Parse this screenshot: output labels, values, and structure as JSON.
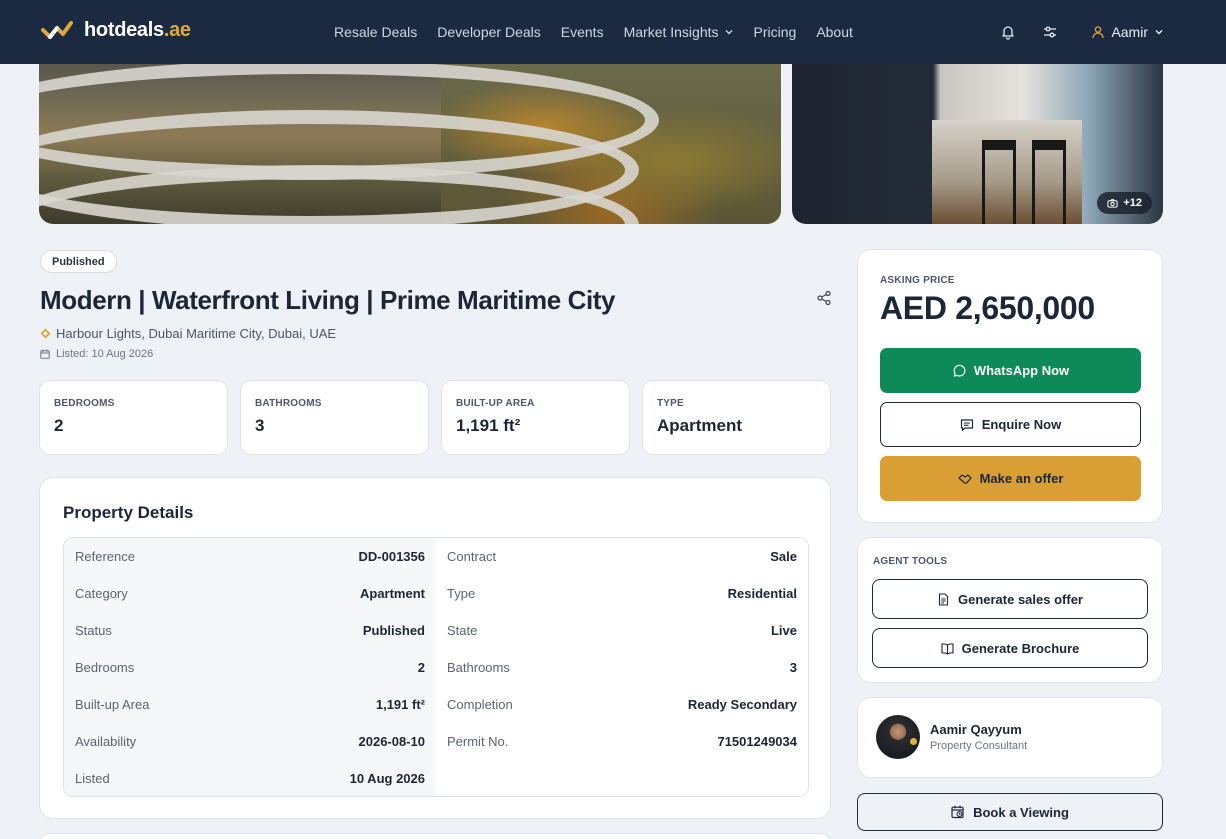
{
  "brand": {
    "name": "hotdeals",
    "tld": ".ae",
    "accent": "#e0a83a",
    "nav_bg": "#1b2a40"
  },
  "nav": {
    "items": [
      {
        "label": "Resale Deals"
      },
      {
        "label": "Developer Deals"
      },
      {
        "label": "Events"
      },
      {
        "label": "Market Insights",
        "dropdown": true
      },
      {
        "label": "Pricing"
      },
      {
        "label": "About"
      }
    ],
    "user": "Aamir",
    "icons": [
      "bell-icon",
      "sliders-icon",
      "user-icon",
      "chevron-down-icon"
    ]
  },
  "gallery": {
    "photo_count": "+12"
  },
  "listing": {
    "status": "Published",
    "title": "Modern | Waterfront Living | Prime Maritime City",
    "location": "Harbour Lights, Dubai Maritime City, Dubai, UAE",
    "listed": "Listed: 10 Aug 2026"
  },
  "stats": [
    {
      "label": "BEDROOMS",
      "value": "2"
    },
    {
      "label": "BATHROOMS",
      "value": "3"
    },
    {
      "label": "BUILT-UP AREA",
      "value": "1,191 ft²"
    },
    {
      "label": "TYPE",
      "value": "Apartment"
    }
  ],
  "details": {
    "heading": "Property Details",
    "rows": [
      {
        "lk": "Reference",
        "lv": "DD-001356",
        "rk": "Contract",
        "rv": "Sale"
      },
      {
        "lk": "Category",
        "lv": "Apartment",
        "rk": "Type",
        "rv": "Residential"
      },
      {
        "lk": "Status",
        "lv": "Published",
        "rk": "State",
        "rv": "Live"
      },
      {
        "lk": "Bedrooms",
        "lv": "2",
        "rk": "Bathrooms",
        "rv": "3"
      },
      {
        "lk": "Built-up Area",
        "lv": "1,191 ft²",
        "rk": "Completion",
        "rv": "Ready Secondary"
      },
      {
        "lk": "Availability",
        "lv": "2026-08-10",
        "rk": "Permit No.",
        "rv": "71501249034"
      },
      {
        "lk": "Listed",
        "lv": "10 Aug 2026",
        "rk": "",
        "rv": ""
      }
    ]
  },
  "pricing": {
    "label": "ASKING PRICE",
    "price": "AED 2,650,000",
    "whatsapp": "WhatsApp Now",
    "enquire": "Enquire Now",
    "offer": "Make an offer",
    "whatsapp_color": "#0d8a57",
    "offer_color": "#d99f35"
  },
  "tools": {
    "label": "AGENT TOOLS",
    "sales_offer": "Generate sales offer",
    "brochure": "Generate Brochure"
  },
  "agent": {
    "name": "Aamir Qayyum",
    "role": "Property Consultant"
  },
  "book": "Book a Viewing"
}
